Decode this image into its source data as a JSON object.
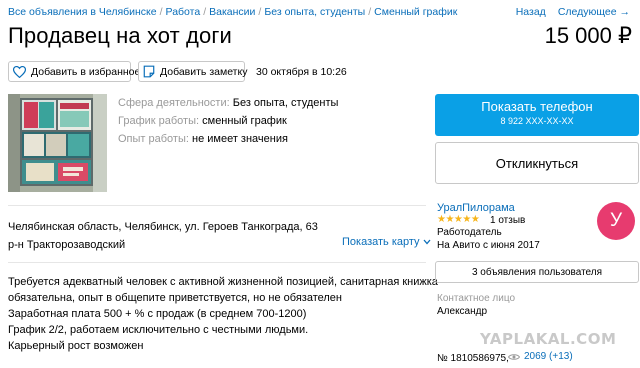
{
  "breadcrumbs": {
    "items": [
      "Все объявления в Челябинске",
      "Работа",
      "Вакансии",
      "Без опыта, студенты",
      "Сменный график"
    ],
    "separator": "/"
  },
  "topnav": {
    "back": "Назад",
    "next": "Следующее →"
  },
  "listing": {
    "title": "Продавец на хот доги",
    "price": "15 000 ₽",
    "date": "30 октября в 10:26",
    "favorite_label": "Добавить в избранное",
    "note_label": "Добавить заметку"
  },
  "params": [
    {
      "key": "Сфера деятельности:",
      "value": "Без опыта, студенты"
    },
    {
      "key": "График работы:",
      "value": "сменный график"
    },
    {
      "key": "Опыт работы:",
      "value": "не имеет значения"
    }
  ],
  "address": {
    "line1": "Челябинская область, Челябинск, ул. Героев Танкограда, 63",
    "line2": "р-н Тракторозаводский",
    "show_map": "Показать карту"
  },
  "description": [
    "Требуется адекватный человек с активной жизненной позицией, санитарная книжка",
    "обязательна, опыт в общепите приветствуется, но не обязателен",
    "Заработная плата 500 + % с продаж (в среднем 700-1200)",
    "График 2/2, работаем исключительно с честными людьми.",
    "Карьерный рост возможен"
  ],
  "sidebar": {
    "phone_button": "Показать телефон",
    "phone_masked": "8 922 XXX-XX-XX",
    "reply_button": "Откликнуться",
    "seller_name": "УралПилорама",
    "stars": "★★★★★",
    "reviews": "1 отзыв",
    "seller_role": "Работодатель",
    "seller_since": "На Авито с июня 2017",
    "avatar_letter": "У",
    "ads_button": "3 объявления пользователя",
    "contact_label": "Контактное лицо",
    "contact_name": "Александр",
    "ad_number": "№ 1810586975,",
    "views": "2069 (+13)"
  },
  "watermark": "YAPLAKAL.COM",
  "colors": {
    "link": "#0a6eb9",
    "primary_button": "#0aa0e6",
    "avatar": "#e73b6f",
    "stars": "#f7b51b"
  }
}
